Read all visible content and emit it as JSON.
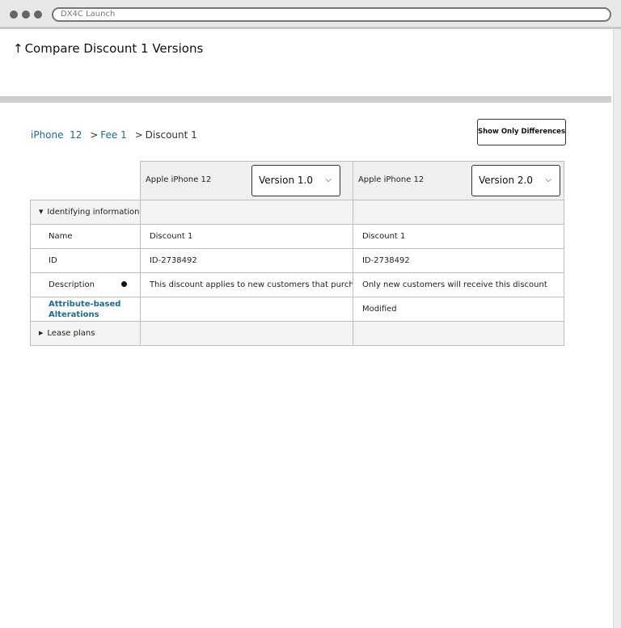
{
  "browser": {
    "url": "DX4C Launch"
  },
  "header": {
    "arrow": "↑",
    "title": "Compare Discount 1 Versions"
  },
  "breadcrumb": {
    "item1": "iPhone  12",
    "sep": ">",
    "item2": "Fee 1",
    "current": "Discount 1"
  },
  "actions": {
    "show_differences": "Show Only Differences"
  },
  "columns": [
    {
      "product": "Apple iPhone 12",
      "version": "Version 1.0"
    },
    {
      "product": "Apple iPhone 12",
      "version": "Version 2.0"
    }
  ],
  "rows": {
    "identifying": {
      "label": "Identifying information",
      "expanded": true
    },
    "name": {
      "label": "Name",
      "v1": "Discount 1",
      "v2": "Discount 1"
    },
    "id": {
      "label": "ID",
      "v1": "ID-2738492",
      "v2": "ID-2738492"
    },
    "description": {
      "label": "Description",
      "v1": "This discount applies to new customers that purchase",
      "v2": "Only new customers will receive this discount",
      "changed_marker": "dot"
    },
    "alterations": {
      "label": "Attribute-based Alterations",
      "v1": "",
      "v2": "Modified"
    },
    "lease": {
      "label": "Lease plans",
      "expanded": false
    }
  },
  "icons": {
    "caret_down": "▼",
    "caret_right": "▶",
    "chevron": "chevron-down-icon"
  },
  "colors": {
    "link": "#1f6b8a",
    "section_bg": "#f3f3f3"
  }
}
